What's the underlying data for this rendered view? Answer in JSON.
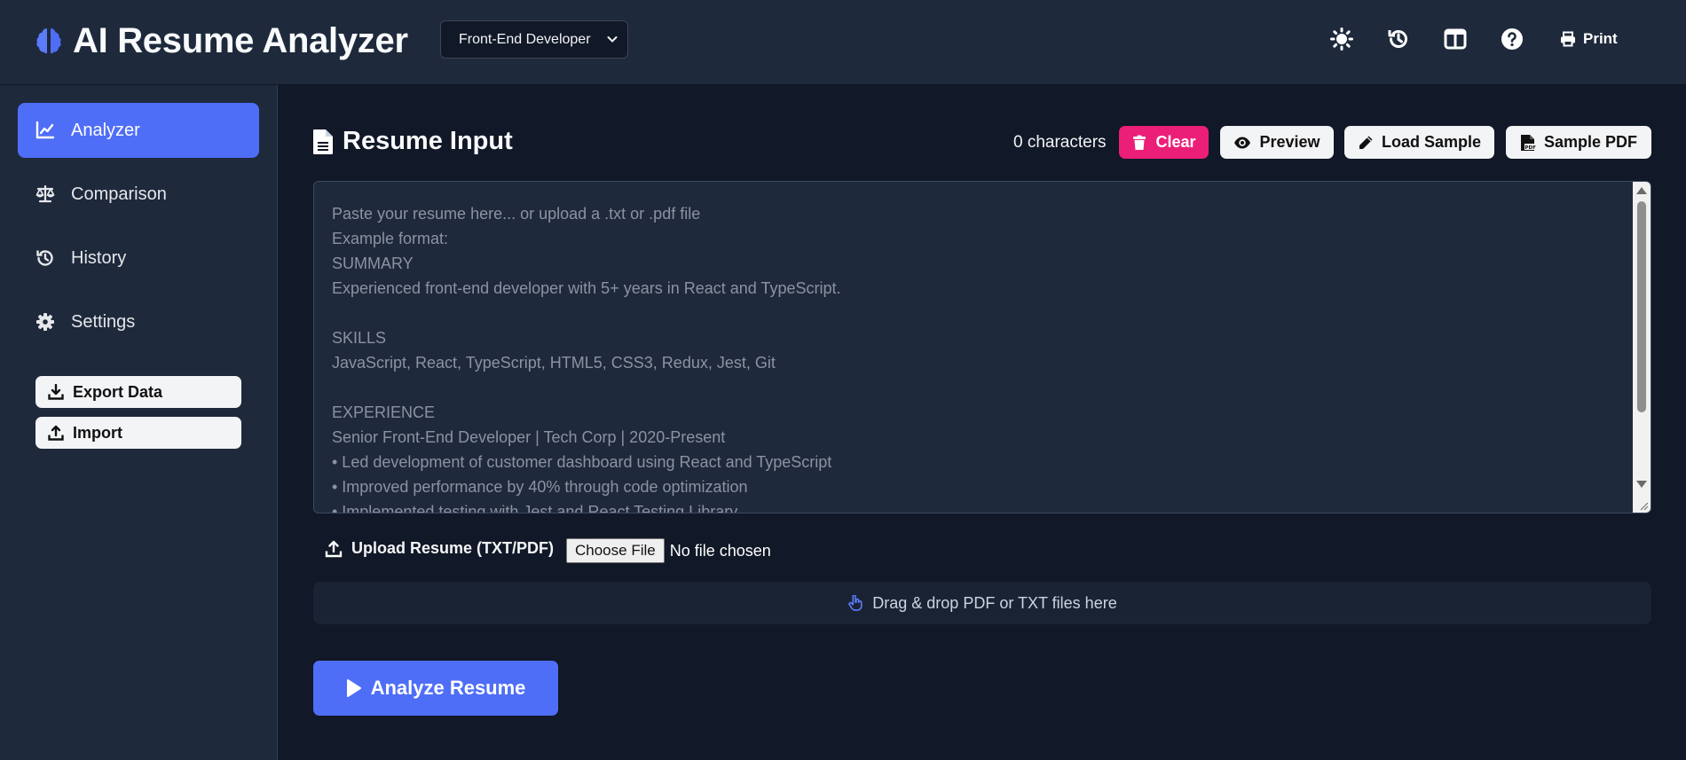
{
  "app": {
    "title": "AI Resume Analyzer"
  },
  "header": {
    "role_select": {
      "value": "Front-End Developer"
    },
    "print_label": "Print"
  },
  "sidebar": {
    "items": [
      {
        "label": "Analyzer",
        "icon": "chart-line-icon",
        "active": true
      },
      {
        "label": "Comparison",
        "icon": "scale-balance-icon",
        "active": false
      },
      {
        "label": "History",
        "icon": "history-icon",
        "active": false
      },
      {
        "label": "Settings",
        "icon": "gear-icon",
        "active": false
      }
    ],
    "export_label": "Export Data",
    "import_label": "Import"
  },
  "main": {
    "section_title": "Resume Input",
    "char_count": "0 characters",
    "toolbar": {
      "clear_label": "Clear",
      "preview_label": "Preview",
      "load_sample_label": "Load Sample",
      "sample_pdf_label": "Sample PDF"
    },
    "textarea": {
      "value": "",
      "placeholder": "Paste your resume here... or upload a .txt or .pdf file\nExample format:\nSUMMARY\nExperienced front-end developer with 5+ years in React and TypeScript.\n\nSKILLS\nJavaScript, React, TypeScript, HTML5, CSS3, Redux, Jest, Git\n\nEXPERIENCE\nSenior Front-End Developer | Tech Corp | 2020-Present\n• Led development of customer dashboard using React and TypeScript\n• Improved performance by 40% through code optimization\n• Implemented testing with Jest and React Testing Library"
    },
    "upload": {
      "label": "Upload Resume (TXT/PDF)",
      "choose_label": "Choose File",
      "file_status": "No file chosen"
    },
    "dropzone_label": "Drag & drop PDF or TXT files here",
    "analyze_label": "Analyze Resume"
  },
  "colors": {
    "accent": "#4f6ef7",
    "danger": "#ec1f78",
    "background": "#111827",
    "panel": "#1e293b"
  }
}
